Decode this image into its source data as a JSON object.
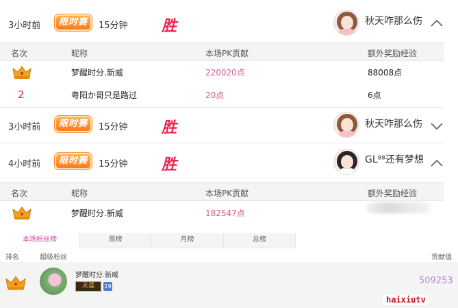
{
  "battles": [
    {
      "time": "3小时前",
      "badge": "限时赛",
      "duration": "15分钟",
      "result": "胜",
      "opponent": "秋天咋那么伤",
      "expanded": true,
      "headers": [
        "名次",
        "昵称",
        "本场PK贡献",
        "额外奖励经验"
      ],
      "rows": [
        {
          "rank": "crown",
          "name": "梦醒时分.新威",
          "pk": "220020点",
          "exp": "88008点"
        },
        {
          "rank": "2",
          "name": "粤阳か哥只是路过",
          "pk": "20点",
          "exp": "6点"
        }
      ]
    },
    {
      "time": "3小时前",
      "badge": "限时赛",
      "duration": "15分钟",
      "result": "胜",
      "opponent": "秋天咋那么伤",
      "expanded": false
    },
    {
      "time": "4小时前",
      "badge": "限时赛",
      "duration": "15分钟",
      "result": "胜",
      "opponent": "GL⁸⁸还有梦想",
      "expanded": true,
      "headers": [
        "名次",
        "昵称",
        "本场PK贡献",
        "额外奖励经验"
      ],
      "rows": [
        {
          "rank": "crown",
          "name": "梦醒时分.新威",
          "pk": "182547点",
          "exp": ""
        }
      ]
    }
  ],
  "fan_tabs": [
    "本场粉丝榜",
    "周榜",
    "月榜",
    "总榜"
  ],
  "fan_headers": {
    "rank": "排名",
    "fan": "超级粉丝",
    "score": "贡献值"
  },
  "fan_rows": [
    {
      "rank": "crown",
      "name": "梦醒时分.新威",
      "badge": "天涯",
      "level": "19",
      "score": "509253"
    }
  ],
  "watermark": "haixiutv",
  "colors": {
    "accent_red": "#e8264f",
    "pk_pink": "#d55a8e",
    "badge_orange": "#ff8a2a",
    "tab_active": "#d04aa8"
  }
}
